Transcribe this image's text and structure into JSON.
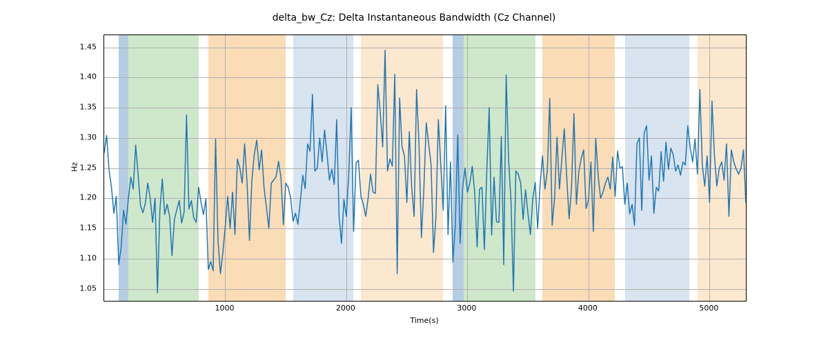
{
  "chart_data": {
    "type": "line",
    "title": "delta_bw_Cz: Delta Instantaneous Bandwidth (Cz Channel)",
    "xlabel": "Time(s)",
    "ylabel": "Hz",
    "xlim": [
      0,
      5300
    ],
    "ylim": [
      1.03,
      1.47
    ],
    "xticks": [
      1000,
      2000,
      3000,
      4000,
      5000
    ],
    "yticks": [
      1.05,
      1.1,
      1.15,
      1.2,
      1.25,
      1.3,
      1.35,
      1.4,
      1.45
    ],
    "xtick_labels": [
      "1000",
      "2000",
      "3000",
      "4000",
      "5000"
    ],
    "ytick_labels": [
      "1.05",
      "1.10",
      "1.15",
      "1.20",
      "1.25",
      "1.30",
      "1.35",
      "1.40",
      "1.45"
    ],
    "background_spans": [
      {
        "from": 120,
        "to": 200,
        "color": "#b5cde3"
      },
      {
        "from": 200,
        "to": 780,
        "color": "#cfe7cb"
      },
      {
        "from": 860,
        "to": 1500,
        "color": "#fadcb7"
      },
      {
        "from": 1560,
        "to": 2060,
        "color": "#d8e4f0"
      },
      {
        "from": 2120,
        "to": 2800,
        "color": "#fce7cf"
      },
      {
        "from": 2880,
        "to": 2970,
        "color": "#b5cde3"
      },
      {
        "from": 2970,
        "to": 3560,
        "color": "#cfe7cb"
      },
      {
        "from": 3620,
        "to": 4220,
        "color": "#fadcb7"
      },
      {
        "from": 4300,
        "to": 4830,
        "color": "#d8e4f0"
      },
      {
        "from": 4900,
        "to": 5300,
        "color": "#fce7cf"
      }
    ],
    "series": [
      {
        "name": "delta_bw_Cz",
        "color": "#1f77b4",
        "x_start": 0,
        "x_step": 20,
        "y": [
          1.275,
          1.304,
          1.247,
          1.218,
          1.175,
          1.203,
          1.09,
          1.118,
          1.18,
          1.157,
          1.2,
          1.235,
          1.215,
          1.288,
          1.24,
          1.188,
          1.176,
          1.192,
          1.225,
          1.2,
          1.16,
          1.2,
          1.043,
          1.18,
          1.232,
          1.173,
          1.19,
          1.17,
          1.105,
          1.165,
          1.181,
          1.196,
          1.159,
          1.177,
          1.338,
          1.182,
          1.196,
          1.167,
          1.16,
          1.218,
          1.193,
          1.173,
          1.199,
          1.082,
          1.095,
          1.08,
          1.298,
          1.13,
          1.075,
          1.11,
          1.153,
          1.203,
          1.15,
          1.21,
          1.14,
          1.265,
          1.25,
          1.225,
          1.29,
          1.225,
          1.13,
          1.23,
          1.273,
          1.296,
          1.247,
          1.28,
          1.218,
          1.185,
          1.15,
          1.225,
          1.23,
          1.236,
          1.261,
          1.234,
          1.156,
          1.225,
          1.218,
          1.2,
          1.162,
          1.175,
          1.157,
          1.195,
          1.238,
          1.216,
          1.29,
          1.278,
          1.372,
          1.245,
          1.25,
          1.3,
          1.26,
          1.313,
          1.275,
          1.23,
          1.248,
          1.223,
          1.33,
          1.17,
          1.125,
          1.198,
          1.17,
          1.24,
          1.35,
          1.145,
          1.258,
          1.263,
          1.204,
          1.19,
          1.17,
          1.2,
          1.24,
          1.21,
          1.208,
          1.388,
          1.342,
          1.285,
          1.445,
          1.245,
          1.265,
          1.253,
          1.405,
          1.075,
          1.366,
          1.285,
          1.27,
          1.193,
          1.31,
          1.217,
          1.17,
          1.38,
          1.29,
          1.135,
          1.214,
          1.325,
          1.29,
          1.255,
          1.11,
          1.17,
          1.33,
          1.255,
          1.18,
          1.353,
          1.14,
          1.26,
          1.094,
          1.155,
          1.305,
          1.125,
          1.215,
          1.25,
          1.21,
          1.225,
          1.253,
          1.21,
          1.119,
          1.215,
          1.218,
          1.115,
          1.245,
          1.35,
          1.139,
          1.235,
          1.161,
          1.16,
          1.302,
          1.09,
          1.404,
          1.265,
          1.195,
          1.046,
          1.245,
          1.24,
          1.225,
          1.165,
          1.214,
          1.175,
          1.14,
          1.2,
          1.226,
          1.15,
          1.22,
          1.27,
          1.215,
          1.245,
          1.365,
          1.155,
          1.2,
          1.301,
          1.215,
          1.265,
          1.315,
          1.235,
          1.166,
          1.218,
          1.34,
          1.19,
          1.244,
          1.266,
          1.28,
          1.183,
          1.197,
          1.26,
          1.145,
          1.299,
          1.237,
          1.2,
          1.21,
          1.225,
          1.235,
          1.215,
          1.268,
          1.203,
          1.278,
          1.25,
          1.252,
          1.19,
          1.225,
          1.174,
          1.19,
          1.155,
          1.29,
          1.3,
          1.18,
          1.308,
          1.32,
          1.23,
          1.27,
          1.175,
          1.218,
          1.212,
          1.277,
          1.228,
          1.293,
          1.248,
          1.283,
          1.272,
          1.245,
          1.255,
          1.238,
          1.26,
          1.255,
          1.32,
          1.283,
          1.26,
          1.298,
          1.24,
          1.38,
          1.255,
          1.22,
          1.27,
          1.193,
          1.361,
          1.271,
          1.22,
          1.25,
          1.26,
          1.23,
          1.29,
          1.17,
          1.28,
          1.26,
          1.248,
          1.24,
          1.25,
          1.28,
          1.192
        ]
      }
    ]
  }
}
